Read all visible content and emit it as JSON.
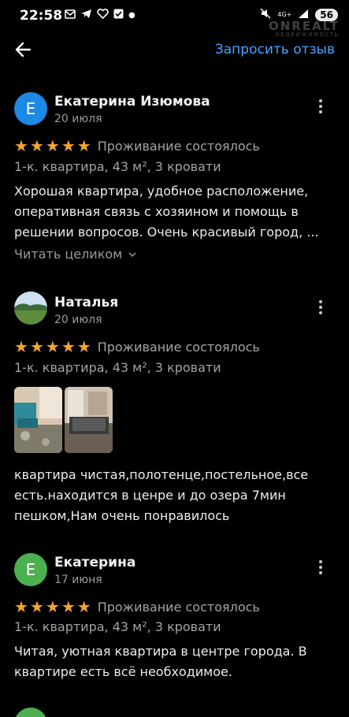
{
  "status_bar": {
    "time": "22:58",
    "signal": "4G+",
    "battery": "56",
    "watermark_main": "ONREALT",
    "watermark_sub": "НЕДВИЖИМОСТЬ"
  },
  "app_bar": {
    "request_review_label": "Запросить отзыв"
  },
  "reviews": [
    {
      "avatar_letter": "Е",
      "avatar_color": "#1e88e5",
      "author": "Екатерина Изюмова",
      "date": "20 июля",
      "stay_status": "Проживание состоялось",
      "listing": "1-к. квартира, 43 м², 3 кровати",
      "text_lines": [
        "Хорошая квартира, удобное расположение,",
        "оперативная связь с хозяином и помощь в",
        "решении вопросов. Очень красивый город, ..."
      ],
      "read_more": "Читать целиком"
    },
    {
      "author": "Наталья",
      "date": "20 июля",
      "stay_status": "Проживание состоялось",
      "listing": "1-к. квартира, 43 м², 3 кровати",
      "text_lines": [
        "квартира чистая,полотенце,постельное,все",
        "есть.находится в ценре и до озера 7мин",
        "пешком,Нам очень понравилось"
      ]
    },
    {
      "avatar_letter": "Е",
      "avatar_color": "#4caf50",
      "author": "Екатерина",
      "date": "17 июня",
      "stay_status": "Проживание состоялось",
      "listing": "1-к. квартира, 43 м², 3 кровати",
      "text_lines": [
        "Читая, уютная квартира в центре города. В",
        "квартире есть всё необходимое."
      ]
    }
  ]
}
